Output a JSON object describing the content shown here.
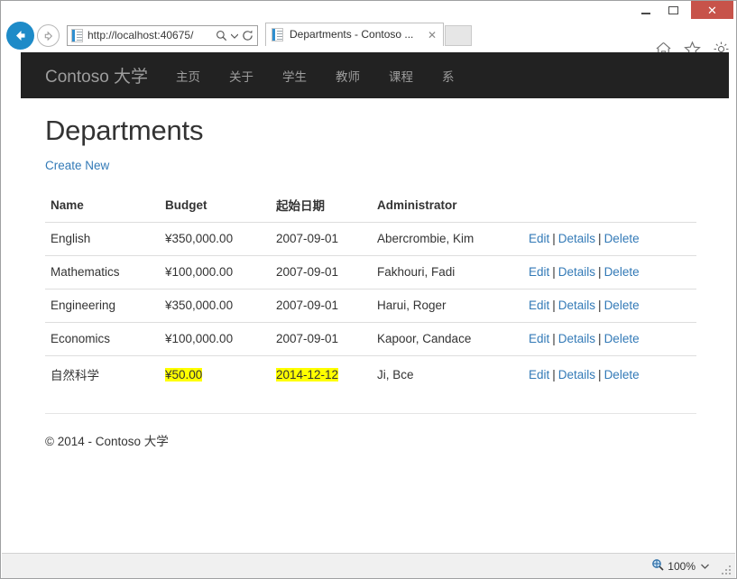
{
  "browser": {
    "window_controls": {
      "minimize": "–",
      "maximize": "□",
      "close": "✕"
    },
    "back_label": "Back",
    "forward_label": "Forward",
    "address": {
      "url": "http://localhost:40675/",
      "search_icon": "search-icon",
      "dropdown_icon": "chevron-down-icon",
      "refresh_icon": "refresh-icon"
    },
    "tab": {
      "title": "Departments - Contoso ...",
      "close": "✕"
    },
    "new_tab_label": "",
    "toolbar_icons": [
      "home-icon",
      "favorites-star-icon",
      "tools-gear-icon"
    ],
    "status": {
      "zoom_level": "100%",
      "zoom_icon": "zoom-magnifier-icon",
      "zoom_caret": "▾"
    }
  },
  "site": {
    "brand": "Contoso 大学",
    "nav": [
      {
        "label": "主页"
      },
      {
        "label": "关于"
      },
      {
        "label": "学生"
      },
      {
        "label": "教师"
      },
      {
        "label": "课程"
      },
      {
        "label": "系"
      }
    ],
    "footer": "© 2014 - Contoso 大学"
  },
  "page": {
    "title": "Departments",
    "create_new": "Create New",
    "table": {
      "headers": [
        "Name",
        "Budget",
        "起始日期",
        "Administrator",
        ""
      ],
      "actions": {
        "edit": "Edit",
        "details": "Details",
        "delete": "Delete",
        "separator": "|"
      },
      "rows": [
        {
          "name": "English",
          "budget": "¥350,000.00",
          "start_date": "2007-09-01",
          "administrator": "Abercrombie, Kim",
          "highlighted": false
        },
        {
          "name": "Mathematics",
          "budget": "¥100,000.00",
          "start_date": "2007-09-01",
          "administrator": "Fakhouri, Fadi",
          "highlighted": false
        },
        {
          "name": "Engineering",
          "budget": "¥350,000.00",
          "start_date": "2007-09-01",
          "administrator": "Harui, Roger",
          "highlighted": false
        },
        {
          "name": "Economics",
          "budget": "¥100,000.00",
          "start_date": "2007-09-01",
          "administrator": "Kapoor, Candace",
          "highlighted": false
        },
        {
          "name": "自然科学",
          "budget": "¥50.00",
          "start_date": "2014-12-12",
          "administrator": "Ji, Bce",
          "highlighted": true
        }
      ]
    }
  },
  "colors": {
    "navbar_bg": "#222222",
    "navbar_text": "#9d9d9d",
    "link": "#337ab7",
    "highlight": "#ffff00",
    "close_button": "#c7534a",
    "back_button": "#1e8bc8"
  }
}
